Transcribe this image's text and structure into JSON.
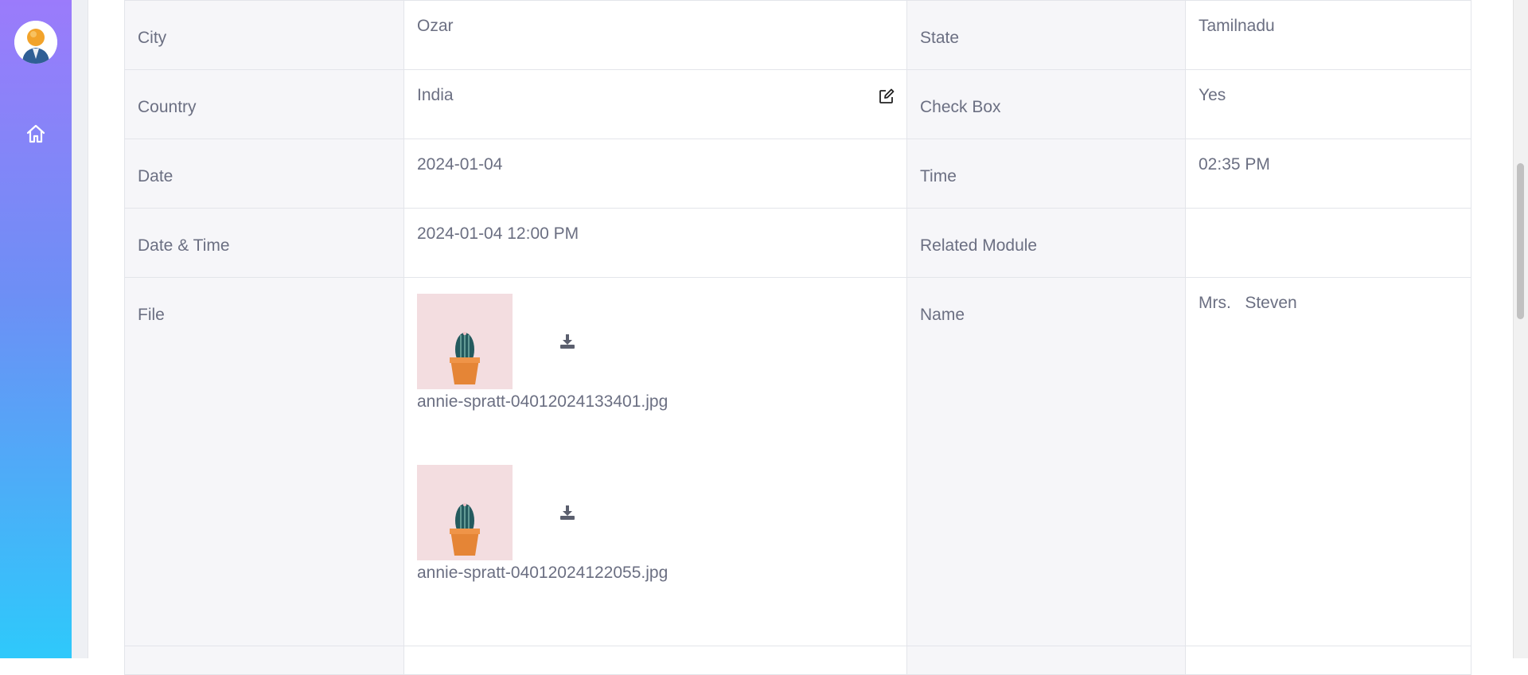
{
  "details": {
    "city": {
      "label": "City",
      "value": "Ozar"
    },
    "state": {
      "label": "State",
      "value": "Tamilnadu"
    },
    "country": {
      "label": "Country",
      "value": "India"
    },
    "checkbox": {
      "label": "Check Box",
      "value": "Yes"
    },
    "date": {
      "label": "Date",
      "value": "2024-01-04"
    },
    "time": {
      "label": "Time",
      "value": "02:35 PM"
    },
    "datetime": {
      "label": "Date & Time",
      "value": "2024-01-04 12:00 PM"
    },
    "related_module": {
      "label": "Related Module",
      "value": ""
    },
    "file": {
      "label": "File",
      "files": [
        {
          "name": "annie-spratt-04012024133401.jpg"
        },
        {
          "name": "annie-spratt-04012024122055.jpg"
        }
      ]
    },
    "name": {
      "label": "Name",
      "value": "Mrs.   Steven"
    }
  },
  "icons": {
    "sidebar": [
      "user-avatar",
      "home-icon"
    ],
    "edit": "edit-icon",
    "download": "download-icon"
  },
  "colors": {
    "sidebar_top": "#9b7bfb",
    "sidebar_bottom": "#2ec9fb",
    "label_bg": "#f6f6f9",
    "text": "#6b6f82"
  }
}
